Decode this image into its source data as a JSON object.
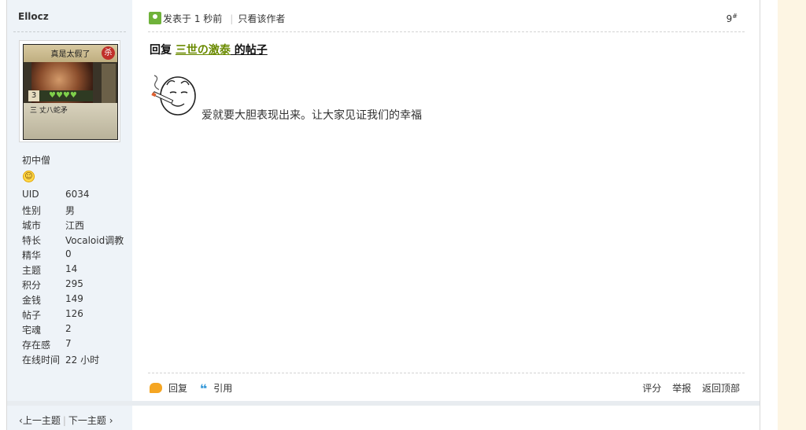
{
  "author": {
    "name": "Ellocz"
  },
  "avatar_card": {
    "title": "真是太假了",
    "badge": "杀",
    "number": "3",
    "lower_text": "三 丈八蛇矛"
  },
  "profile": {
    "rank": "初中僧",
    "rank_icon": "smiley-icon",
    "stats": [
      {
        "key": "UID",
        "value": "6034"
      },
      {
        "key": "性别",
        "value": "男"
      },
      {
        "key": "城市",
        "value": "江西"
      },
      {
        "key": "特长",
        "value": "Vocaloid调教"
      },
      {
        "key": "精华",
        "value": "0"
      },
      {
        "key": "主题",
        "value": "14"
      },
      {
        "key": "积分",
        "value": "295"
      },
      {
        "key": "金钱",
        "value": "149"
      },
      {
        "key": "帖子",
        "value": "126"
      },
      {
        "key": "宅魂",
        "value": "2"
      },
      {
        "key": "存在感",
        "value": "7"
      },
      {
        "key": "在线时间",
        "value": "22 小时"
      }
    ]
  },
  "post": {
    "posted_label": "发表于 1 秒前",
    "only_author_label": "只看该作者",
    "floor": "9",
    "floor_suffix": "#",
    "reply_prefix": "回复 ",
    "reply_user": "三世の激泰",
    "reply_suffix": " 的帖子",
    "message": "爱就要大胆表现出来。让大家见证我们的幸福"
  },
  "actions": {
    "reply": "回复",
    "quote": "引用",
    "rate": "评分",
    "report": "举报",
    "top": "返回顶部"
  },
  "thread_nav": {
    "prev": "上一主题",
    "next": "下一主题"
  },
  "colors": {
    "sidebar_bg": "#eef3f8",
    "link_green": "#6a8a00",
    "right_strip": "#fdf5e3"
  }
}
